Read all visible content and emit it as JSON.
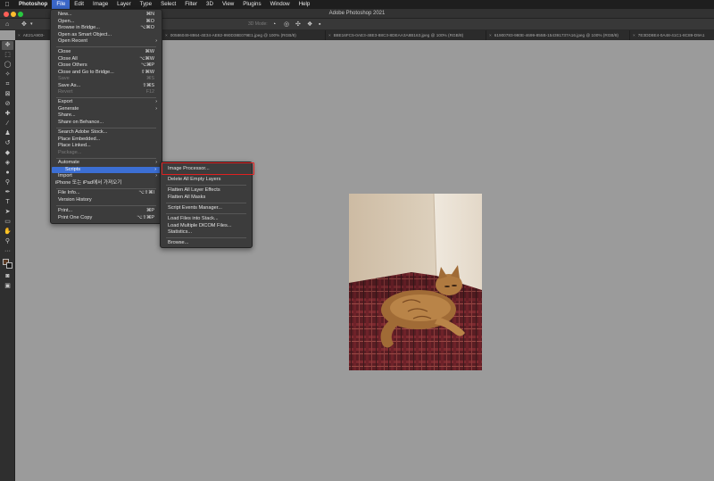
{
  "menubar": {
    "apple_icon": "apple-icon",
    "items": [
      "Photoshop",
      "File",
      "Edit",
      "Image",
      "Layer",
      "Type",
      "Select",
      "Filter",
      "3D",
      "View",
      "Plugins",
      "Window",
      "Help"
    ]
  },
  "window": {
    "title": "Adobe Photoshop 2021",
    "traffic_colors": [
      "#ff5f57",
      "#febc2e",
      "#28c840"
    ]
  },
  "optionsbar": {
    "mode_3d": "3D Mode:"
  },
  "tabs": [
    "AE21A903-",
    "00586049-8864-4E34-AE82-990D38E079E1.jpeg @ 100% (RGB/8)",
    "B8E16FC5-0AE3-48E3-88C3-8DEAA3A8B163.jpeg @ 100% (RGB/8)",
    "61900783-980E-4699-855B-154391737A16.jpeg @ 100% (RGB/8)",
    "7E3DD8E4-0A48-41C1-8C89-D9A1"
  ],
  "file_menu": [
    {
      "label": "New...",
      "shortcut": "⌘N"
    },
    {
      "label": "Open...",
      "shortcut": "⌘O"
    },
    {
      "label": "Browse in Bridge...",
      "shortcut": "⌥⌘O"
    },
    {
      "label": "Open as Smart Object...",
      "shortcut": ""
    },
    {
      "label": "Open Recent",
      "shortcut": "",
      "submenu": true
    },
    {
      "label": "Close",
      "shortcut": "⌘W"
    },
    {
      "label": "Close All",
      "shortcut": "⌥⌘W"
    },
    {
      "label": "Close Others",
      "shortcut": "⌥⌘P"
    },
    {
      "label": "Close and Go to Bridge...",
      "shortcut": "⇧⌘W"
    },
    {
      "label": "Save",
      "shortcut": "⌘S",
      "disabled": true
    },
    {
      "label": "Save As...",
      "shortcut": "⇧⌘S"
    },
    {
      "label": "Revert",
      "shortcut": "F12",
      "disabled": true
    },
    {
      "label": "Export",
      "shortcut": "",
      "submenu": true
    },
    {
      "label": "Generate",
      "shortcut": "",
      "submenu": true
    },
    {
      "label": "Share...",
      "shortcut": ""
    },
    {
      "label": "Share on Behance...",
      "shortcut": ""
    },
    {
      "label": "Search Adobe Stock...",
      "shortcut": ""
    },
    {
      "label": "Place Embedded...",
      "shortcut": ""
    },
    {
      "label": "Place Linked...",
      "shortcut": ""
    },
    {
      "label": "Package...",
      "shortcut": "",
      "disabled": true
    },
    {
      "label": "Automate",
      "shortcut": "",
      "submenu": true
    },
    {
      "label": "Scripts",
      "shortcut": "",
      "submenu": true,
      "highlighted": true
    },
    {
      "label": "Import",
      "shortcut": "",
      "submenu": true
    },
    {
      "label": "iPhone 또는 iPad에서 가져오기",
      "shortcut": ""
    },
    {
      "label": "File Info...",
      "shortcut": "⌥⇧⌘I"
    },
    {
      "label": "Version History",
      "shortcut": ""
    },
    {
      "label": "Print...",
      "shortcut": "⌘P"
    },
    {
      "label": "Print One Copy",
      "shortcut": "⌥⇧⌘P"
    }
  ],
  "scripts_menu": [
    "Image Processor...",
    "Delete All Empty Layers",
    "Flatten All Layer Effects",
    "Flatten All Masks",
    "Script Events Manager...",
    "Load Files into Stack...",
    "Load Multiple DICOM Files...",
    "Statistics...",
    "Browse..."
  ],
  "colors": {
    "highlight": "#3c6fd4",
    "callout": "#e02020",
    "foreground_swatch": "#5a3a24",
    "background_swatch": "#1a1a1a"
  }
}
